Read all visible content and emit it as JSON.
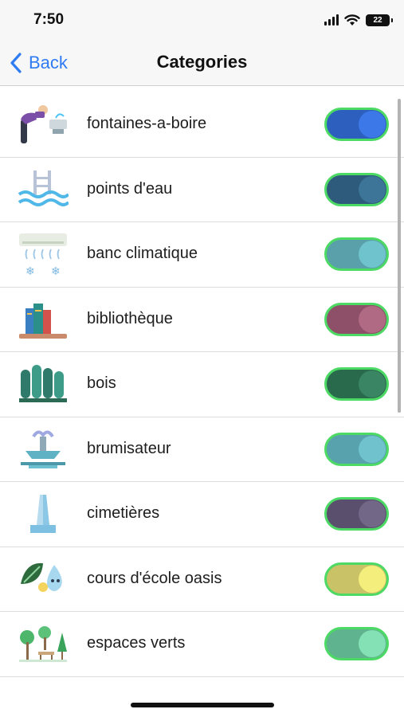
{
  "status_bar": {
    "time": "7:50",
    "battery": "22"
  },
  "nav": {
    "back_label": "Back",
    "title": "Categories"
  },
  "categories": [
    {
      "label": "fontaines-a-boire",
      "icon": "drinking-fountain-icon",
      "enabled": true,
      "track_color": "#2d5fbf",
      "knob_color": "#3d78e8"
    },
    {
      "label": "points d'eau",
      "icon": "pool-water-icon",
      "enabled": true,
      "track_color": "#2e5b7c",
      "knob_color": "#3c7598"
    },
    {
      "label": "banc climatique",
      "icon": "air-conditioner-icon",
      "enabled": true,
      "track_color": "#5aa0ab",
      "knob_color": "#6ec3cc"
    },
    {
      "label": "bibliothèque",
      "icon": "books-icon",
      "enabled": true,
      "track_color": "#8e4f68",
      "knob_color": "#b16a84"
    },
    {
      "label": "bois",
      "icon": "forest-icon",
      "enabled": true,
      "track_color": "#2a6a4c",
      "knob_color": "#3a8563"
    },
    {
      "label": "brumisateur",
      "icon": "mist-fountain-icon",
      "enabled": true,
      "track_color": "#58a2ae",
      "knob_color": "#70c3cd"
    },
    {
      "label": "cimetières",
      "icon": "obelisk-icon",
      "enabled": true,
      "track_color": "#5a4f6c",
      "knob_color": "#736788"
    },
    {
      "label": "cours d'école oasis",
      "icon": "leaf-drop-icon",
      "enabled": true,
      "track_color": "#c9c267",
      "knob_color": "#f4ef7c"
    },
    {
      "label": "espaces verts",
      "icon": "park-icon",
      "enabled": true,
      "track_color": "#5fb48f",
      "knob_color": "#84e0b5"
    }
  ]
}
